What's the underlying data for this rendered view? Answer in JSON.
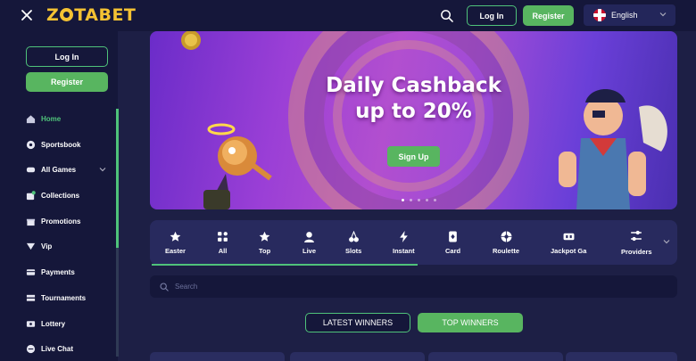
{
  "header": {
    "brand": {
      "pre": "Z",
      "post": "TABET"
    },
    "login_label": "Log In",
    "register_label": "Register",
    "language": "English"
  },
  "sidebar": {
    "login_label": "Log In",
    "register_label": "Register",
    "items": [
      {
        "label": "Home",
        "icon": "home-icon",
        "active": true
      },
      {
        "label": "Sportsbook",
        "icon": "soccer-ball-icon"
      },
      {
        "label": "All Games",
        "icon": "game-controller-icon",
        "has_chevron": true
      },
      {
        "label": "Collections",
        "icon": "collection-icon"
      },
      {
        "label": "Promotions",
        "icon": "gift-icon"
      },
      {
        "label": "Vip",
        "icon": "vip-icon"
      },
      {
        "label": "Payments",
        "icon": "wallet-icon"
      },
      {
        "label": "Tournaments",
        "icon": "trophy-icon"
      },
      {
        "label": "Lottery",
        "icon": "ticket-icon"
      },
      {
        "label": "Live Chat",
        "icon": "chat-icon"
      }
    ]
  },
  "banner": {
    "title_line1": "Daily Cashback",
    "title_line2": "up to 20%",
    "cta_label": "Sign Up"
  },
  "categories": [
    {
      "label": "Easter",
      "icon": "star-icon"
    },
    {
      "label": "All",
      "icon": "grid-icon"
    },
    {
      "label": "Top",
      "icon": "star-icon"
    },
    {
      "label": "Live",
      "icon": "dealer-icon"
    },
    {
      "label": "Slots",
      "icon": "cherry-icon"
    },
    {
      "label": "Instant",
      "icon": "lightning-icon"
    },
    {
      "label": "Card",
      "icon": "card-icon"
    },
    {
      "label": "Roulette",
      "icon": "roulette-icon"
    },
    {
      "label": "Jackpot Ga",
      "icon": "jackpot-icon"
    },
    {
      "label": "Providers",
      "icon": "sliders-icon"
    }
  ],
  "search": {
    "placeholder": "Search"
  },
  "winners_tabs": {
    "latest": "LATEST WINNERS",
    "top": "TOP WINNERS"
  },
  "colors": {
    "accent": "#58b560",
    "background": "#1d1f45",
    "panel": "#15173a",
    "logo": "#f4c233"
  }
}
